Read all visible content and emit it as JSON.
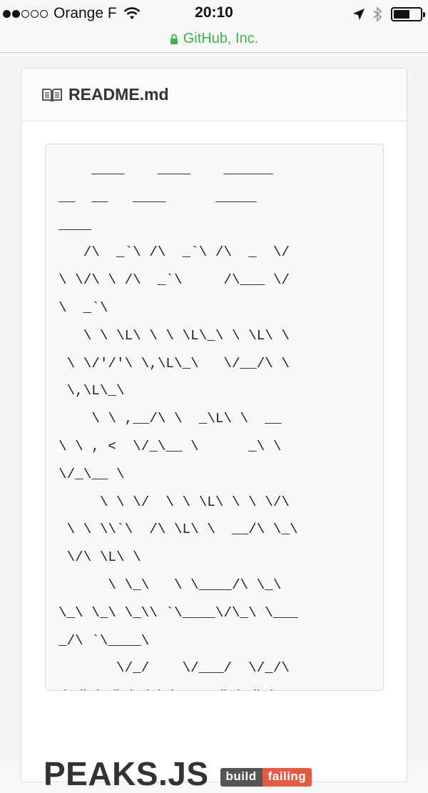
{
  "status_bar": {
    "carrier": "Orange F",
    "time": "20:10",
    "signal_bars_filled": 2,
    "signal_bars_total": 5
  },
  "address_bar": {
    "site": "GitHub, Inc.",
    "accent_color": "#3fb34f"
  },
  "readme": {
    "icon": "book-icon",
    "title": "README.md",
    "ascii_art": "    ____    ____    ______\n__  __   ____      _____\n____\n   /\\  _`\\ /\\  _`\\ /\\  _  \\/\n\\ \\/\\ \\ /\\  _`\\     /\\___ \\/\n\\  _`\\\n   \\ \\ \\L\\ \\ \\ \\L\\_\\ \\ \\L\\ \\\n \\ \\/'/'\\ \\,\\L\\_\\   \\/__/\\ \\\n \\,\\L\\_\\\n    \\ \\ ,__/\\ \\  _\\L\\ \\  __\n\\ \\ , <  \\/_\\__ \\      _\\ \\\n\\/_\\__ \\\n     \\ \\ \\/  \\ \\ \\L\\ \\ \\ \\/\\\n \\ \\ \\\\`\\  /\\ \\L\\ \\  __/\\ \\_\\\n \\/\\ \\L\\ \\\n      \\ \\_\\   \\ \\____/\\ \\_\\\n\\_\\ \\_\\ \\_\\\\ `\\____\\/\\_\\ \\___\n_/\\ `\\____\\\n       \\/_/    \\/___/  \\/_/\\\n/_/\\/_/\\/_/ \\/_____/\\/_/\\/___\n/  \\/_____/",
    "project_title": "PEAKS.JS",
    "badge_left": "build",
    "badge_right": "failing"
  }
}
